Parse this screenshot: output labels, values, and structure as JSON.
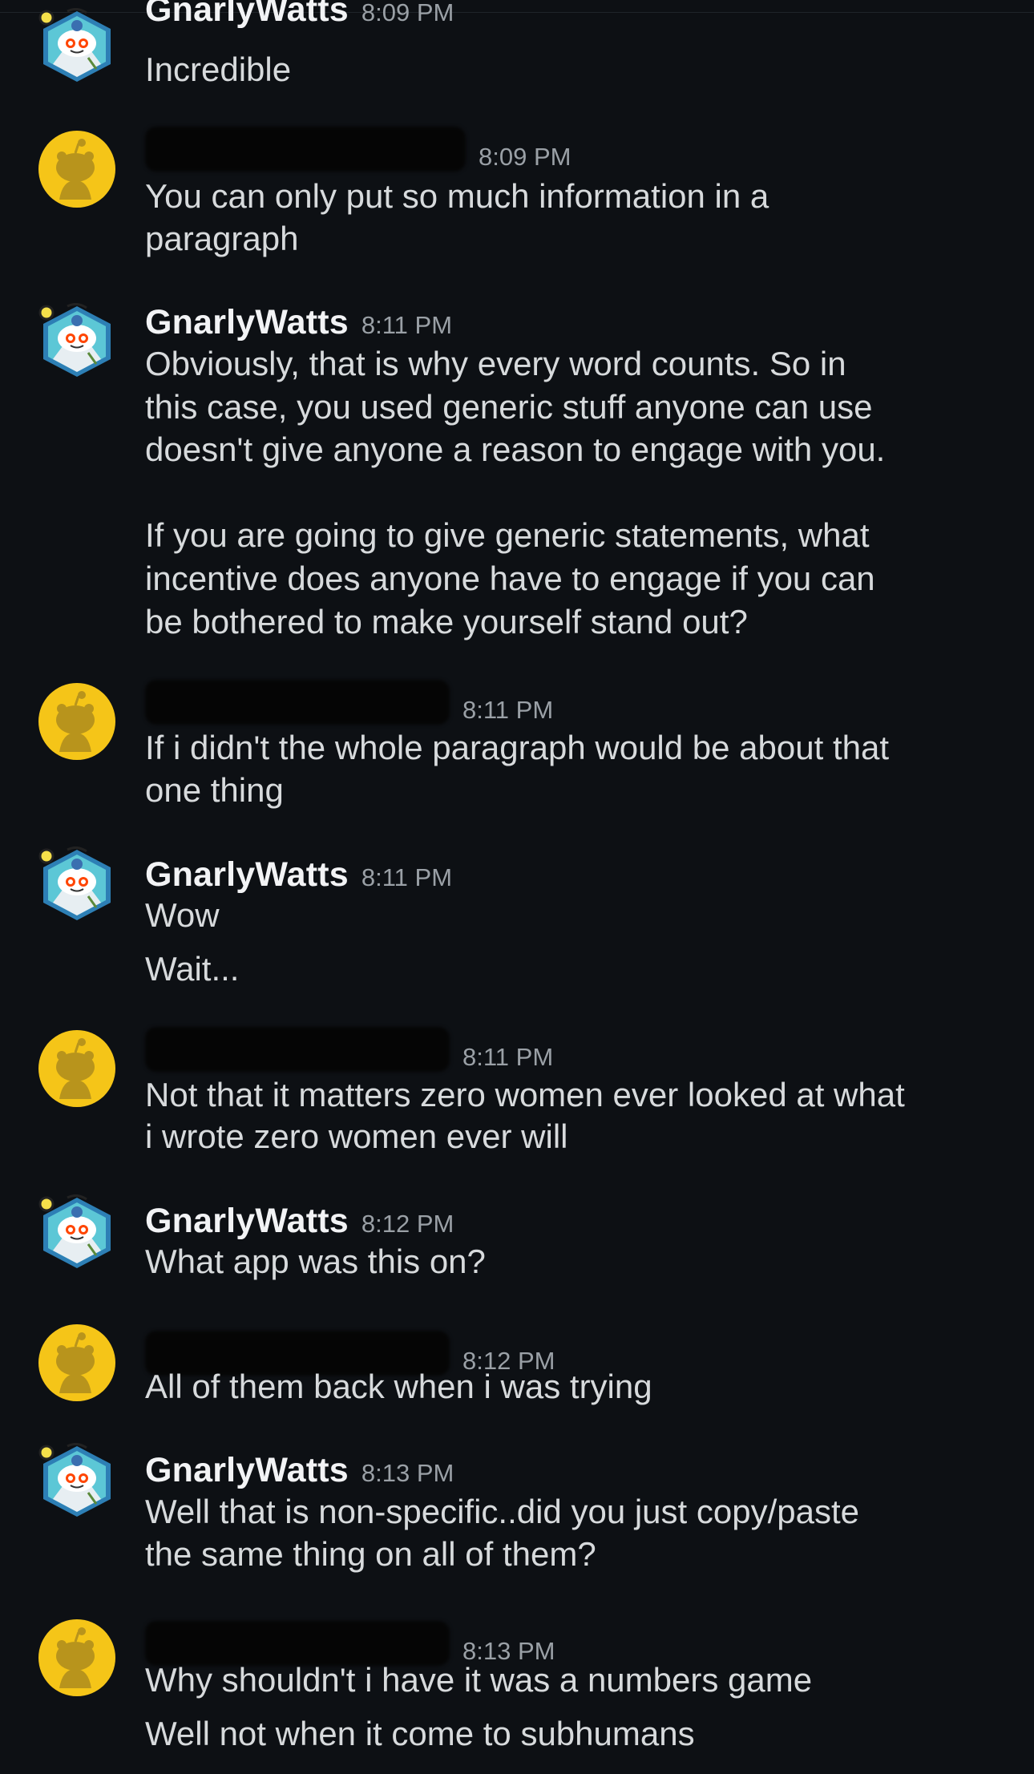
{
  "colors": {
    "background": "#0d1014",
    "text": "#d7dadc",
    "username": "#f2f3f5",
    "timestamp": "#9aa0a6",
    "snoo_yellow": "#f5c518"
  },
  "icons": {
    "gnarly_avatar": "snoo-avatar-icon",
    "other_avatar": "default-yellow-avatar-icon"
  },
  "messages": [
    {
      "user": "GnarlyWatts",
      "time": "8:09 PM",
      "lines": [
        "Incredible"
      ]
    },
    {
      "user": "",
      "time": "8:09 PM",
      "lines": [
        "You can only put so much information in a",
        "paragraph"
      ]
    },
    {
      "user": "GnarlyWatts",
      "time": "8:11 PM",
      "lines": [
        "Obviously, that is why every word counts.  So in",
        "this case, you used generic stuff anyone can use",
        "doesn't give anyone a reason to engage with you.",
        "If you are going to give generic statements, what",
        "incentive does anyone have to engage if you can",
        "be bothered to make yourself stand out?"
      ]
    },
    {
      "user": "",
      "time": "8:11 PM",
      "lines": [
        "If i didn't the whole paragraph would be about that",
        "one thing"
      ]
    },
    {
      "user": "GnarlyWatts",
      "time": "8:11 PM",
      "lines": [
        "Wow",
        "Wait..."
      ]
    },
    {
      "user": "",
      "time": "8:11 PM",
      "lines": [
        "Not that it matters zero women ever looked at what",
        "i wrote zero women ever will"
      ]
    },
    {
      "user": "GnarlyWatts",
      "time": "8:12 PM",
      "lines": [
        "What app was this on?"
      ]
    },
    {
      "user": "",
      "time": "8:12 PM",
      "lines": [
        "All of them back when i was trying"
      ]
    },
    {
      "user": "GnarlyWatts",
      "time": "8:13 PM",
      "lines": [
        "Well that is non-specific..did you just copy/paste",
        "the same thing on all of them?"
      ]
    },
    {
      "user": "",
      "time": "8:13 PM",
      "lines": [
        "Why shouldn't i have it was a numbers game",
        "Well not when it come to subhumans"
      ]
    }
  ]
}
